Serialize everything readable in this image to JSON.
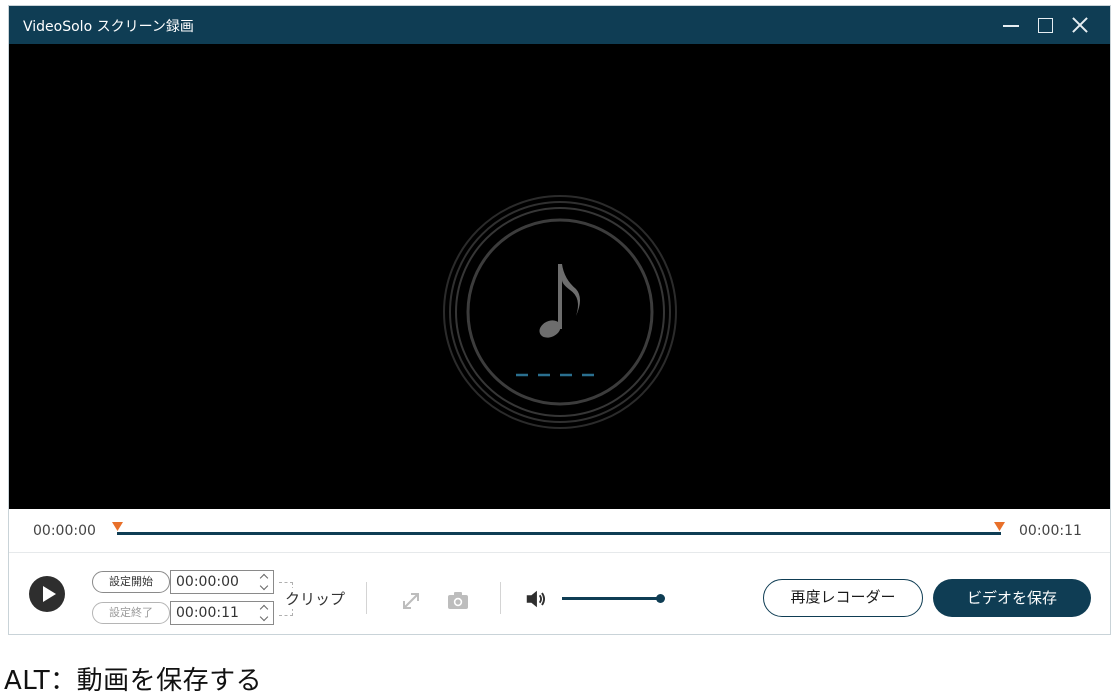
{
  "window": {
    "title": "VideoSolo スクリーン録画",
    "controls": [
      "minimize-icon",
      "maximize-icon",
      "close-icon"
    ]
  },
  "player": {
    "placeholder_icon": "music-note-icon",
    "audio_indicator": "dashed-line"
  },
  "timeline": {
    "start_time": "00:00:00",
    "end_time": "00:00:11"
  },
  "clip": {
    "start_label": "設定開始",
    "end_label": "設定終了",
    "start_value": "00:00:00",
    "end_value": "00:00:11",
    "clip_label": "クリップ"
  },
  "toolbar": {
    "expand_icon": "expand-icon",
    "camera_icon": "camera-icon",
    "volume_icon": "speaker-icon",
    "volume_level": 1.0
  },
  "actions": {
    "rerecord_label": "再度レコーダー",
    "save_label": "ビデオを保存"
  },
  "caption": {
    "alt": "ALT：動画を保存する"
  },
  "colors": {
    "titlebar": "#0f3d54",
    "accent": "#0f3d54",
    "marker": "#e8702a",
    "player_bg": "#000000"
  }
}
